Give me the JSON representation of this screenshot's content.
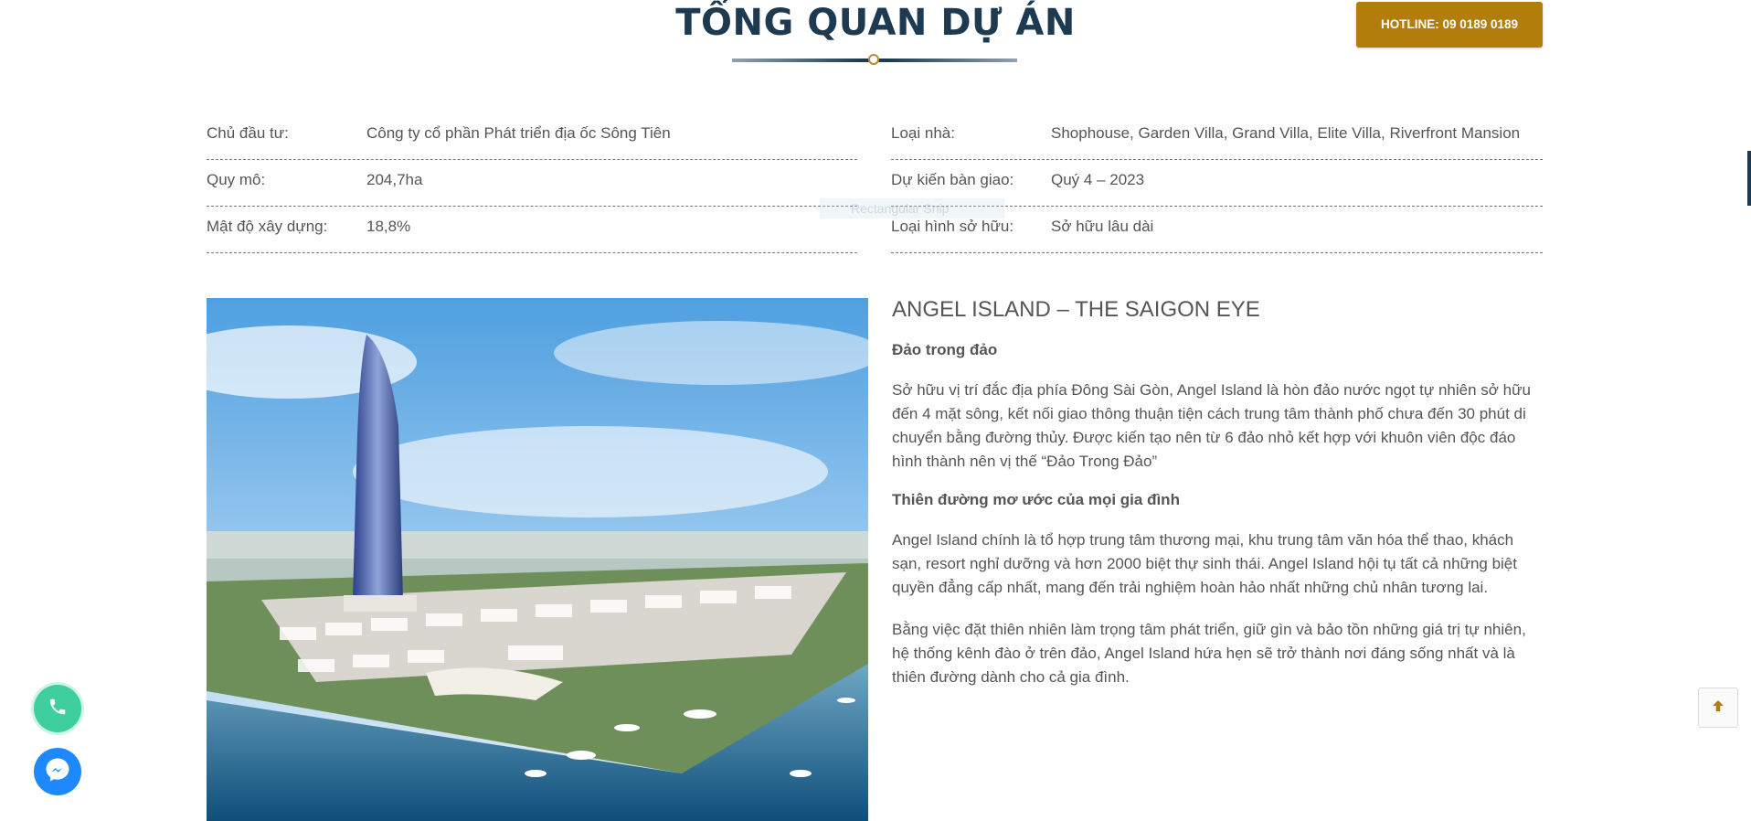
{
  "header": {
    "title": "TỔNG QUAN DỰ ÁN",
    "hotline": "HOTLINE: 09 0189 0189"
  },
  "overview_left": [
    {
      "label": "Chủ đầu tư:",
      "value": "Công ty cổ phần Phát triển địa ốc Sông Tiên"
    },
    {
      "label": "Quy mô:",
      "value": "204,7ha"
    },
    {
      "label": "Mật độ xây dựng:",
      "value": "18,8%"
    }
  ],
  "overview_right": [
    {
      "label": "Loại nhà:",
      "value": "Shophouse, Garden Villa, Grand Villa, Elite Villa, Riverfront Mansion"
    },
    {
      "label": "Dự kiến bàn giao:",
      "value": "Quý 4 – 2023"
    },
    {
      "label": "Loại hình sở hữu:",
      "value": "Sở hữu lâu dài"
    }
  ],
  "overlay": {
    "snip_label": "Rectangular Snip"
  },
  "article": {
    "heading": "ANGEL ISLAND – THE SAIGON EYE",
    "subheading_1": "Đảo trong đảo",
    "paragraph_1": "Sở hữu vị trí đắc địa phía Đông Sài Gòn, Angel Island là hòn đảo nước ngọt tự nhiên sở hữu đến 4 mặt sông, kết nối giao thông thuận tiện cách trung tâm thành phố chưa đến 30 phút di chuyển bằng đường thủy. Được kiến tạo nên từ 6 đảo nhỏ kết hợp với khuôn viên độc đáo hình thành nên vị thế “Đảo Trong Đảo”",
    "subheading_2": "Thiên đường mơ ước của mọi gia đình",
    "paragraph_2": "Angel Island chính là tổ hợp trung tâm thương mại, khu trung tâm văn hóa thể thao, khách sạn, resort nghỉ dưỡng và hơn 2000 biệt thự sinh thái. Angel Island hội tụ tất cả những biệt quyền đẳng cấp nhất, mang đến trải nghiệm hoàn hảo nhất những chủ nhân tương lai.",
    "paragraph_3": "Bằng việc đặt thiên nhiên làm trọng tâm phát triển, giữ gìn và bảo tồn những giá trị tự nhiên, hệ thống kênh đào ở trên đảo, Angel Island hứa hẹn sẽ trở thành nơi đáng sống nhất và là thiên đường dành cho cả gia đình."
  },
  "icons": {
    "phone": "phone-icon",
    "messenger": "messenger-icon",
    "scroll_top": "arrow-up-icon"
  },
  "colors": {
    "title": "#1d3a50",
    "hotline_bg": "#b37d0c",
    "phone_bg": "#3fcf9f",
    "messenger_bg": "#1e88ff",
    "scroll_arrow": "#b37d0c"
  }
}
